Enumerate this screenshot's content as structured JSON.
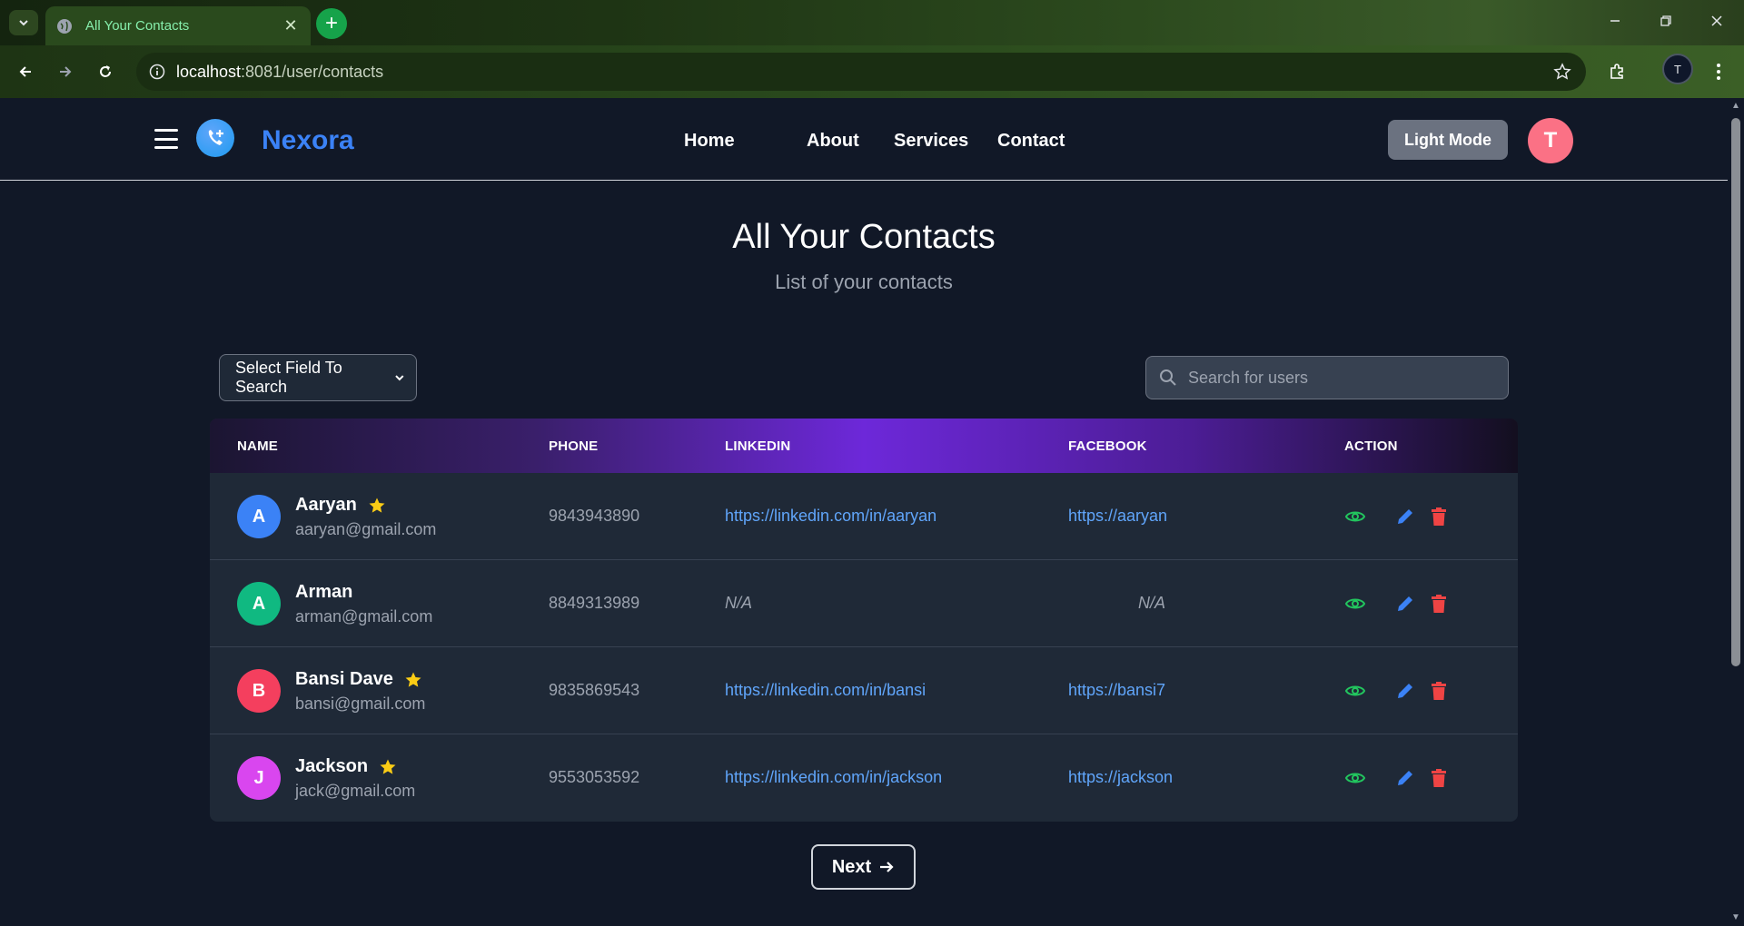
{
  "browser": {
    "tab_title": "All Your Contacts",
    "new_tab": "+",
    "tab_close": "✕",
    "url_host": "localhost",
    "url_rest": ":8081/user/contacts",
    "profile_initial": "T"
  },
  "navbar": {
    "brand": "Nexora",
    "links": [
      "Home",
      "About",
      "Services",
      "Contact"
    ],
    "theme_button": "Light Mode",
    "user_initial": "T"
  },
  "page": {
    "title": "All Your Contacts",
    "subtitle": "List of your contacts"
  },
  "filters": {
    "select_label": "Select Field To Search",
    "search_placeholder": "Search for users"
  },
  "table": {
    "headers": [
      "NAME",
      "PHONE",
      "LINKEDIN",
      "FACEBOOK",
      "ACTION"
    ],
    "rows": [
      {
        "initial": "A",
        "avatar_color": "#3b82f6",
        "name": "Aaryan",
        "favorite": true,
        "email": "aaryan@gmail.com",
        "phone": "9843943890",
        "linkedin": "https://linkedin.com/in/aaryan",
        "facebook": "https://aaryan"
      },
      {
        "initial": "A",
        "avatar_color": "#10b981",
        "name": "Arman",
        "favorite": false,
        "email": "arman@gmail.com",
        "phone": "8849313989",
        "linkedin": "N/A",
        "facebook": "N/A"
      },
      {
        "initial": "B",
        "avatar_color": "#f43f5e",
        "name": "Bansi Dave",
        "favorite": true,
        "email": "bansi@gmail.com",
        "phone": "9835869543",
        "linkedin": "https://linkedin.com/in/bansi",
        "facebook": "https://bansi7"
      },
      {
        "initial": "J",
        "avatar_color": "#d946ef",
        "name": "Jackson",
        "favorite": true,
        "email": "jack@gmail.com",
        "phone": "9553053592",
        "linkedin": "https://linkedin.com/in/jackson",
        "facebook": "https://jackson"
      }
    ],
    "action_icons": [
      "eye-icon",
      "pencil-icon",
      "trash-icon"
    ]
  },
  "pagination": {
    "next_label": "Next"
  },
  "colors": {
    "accent_blue": "#3b82f6",
    "view_green": "#22c55e",
    "edit_blue": "#3b82f6",
    "delete_red": "#ef4444",
    "star_yellow": "#facc15"
  }
}
